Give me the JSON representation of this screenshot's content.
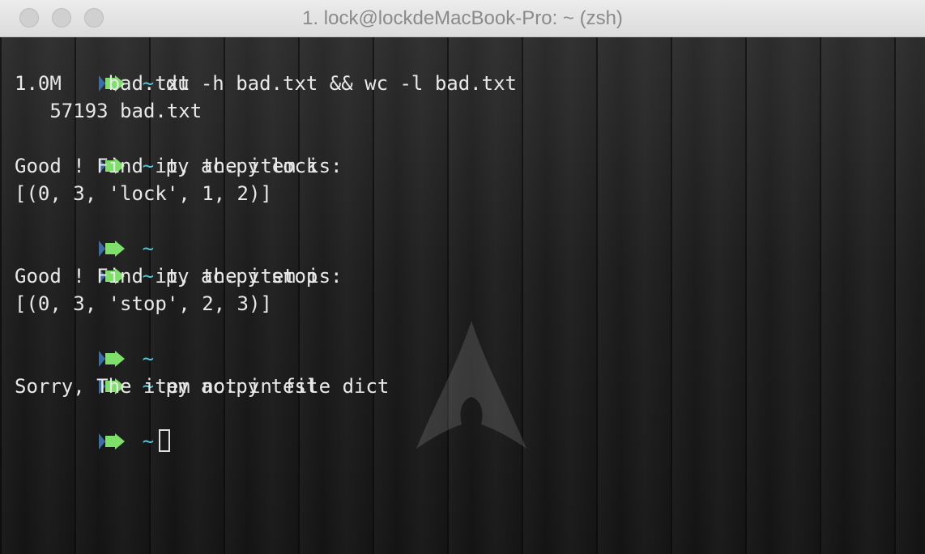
{
  "window": {
    "title": "1. lock@lockdeMacBook-Pro: ~ (zsh)"
  },
  "prompt": {
    "symbol": "~",
    "arrow_color": "#7ee06a",
    "tilde_color": "#4fc9d8"
  },
  "lines": {
    "l1": "du -h bad.txt && wc -l bad.txt",
    "l2": "1.0M    bad.txt",
    "l3": "   57193 bad.txt",
    "l4": "py ac.py lock",
    "l5": "Good ! Find it, the item is:",
    "l6": "[(0, 3, 'lock', 1, 2)]",
    "l7": "",
    "l8": "py ac.py stop",
    "l9": "Good ! Find it, the item is:",
    "l10": "[(0, 3, 'stop', 2, 3)]",
    "l11": "",
    "l12": "py ac.py test",
    "l13": "Sorry, The item not in file dict",
    "l14": ""
  }
}
